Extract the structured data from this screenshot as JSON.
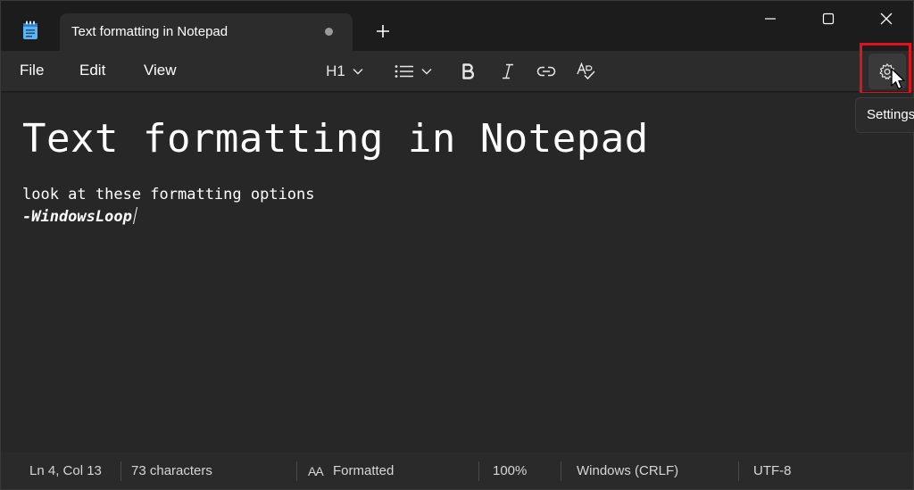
{
  "tab": {
    "title": "Text formatting in Notepad"
  },
  "menu": {
    "file": "File",
    "edit": "Edit",
    "view": "View"
  },
  "toolbar": {
    "heading_label": "H1"
  },
  "tooltip": {
    "settings": "Settings"
  },
  "document": {
    "heading": "Text formatting in Notepad",
    "line1": "look at these formatting options",
    "line2": "-WindowsLoop"
  },
  "status": {
    "position": "Ln 4, Col 13",
    "characters": "73 characters",
    "format_icon": "AA",
    "format": "Formatted",
    "zoom": "100%",
    "line_endings": "Windows (CRLF)",
    "encoding": "UTF-8"
  },
  "colors": {
    "highlight": "#e0121b",
    "background": "#202020",
    "editor": "#272727"
  }
}
